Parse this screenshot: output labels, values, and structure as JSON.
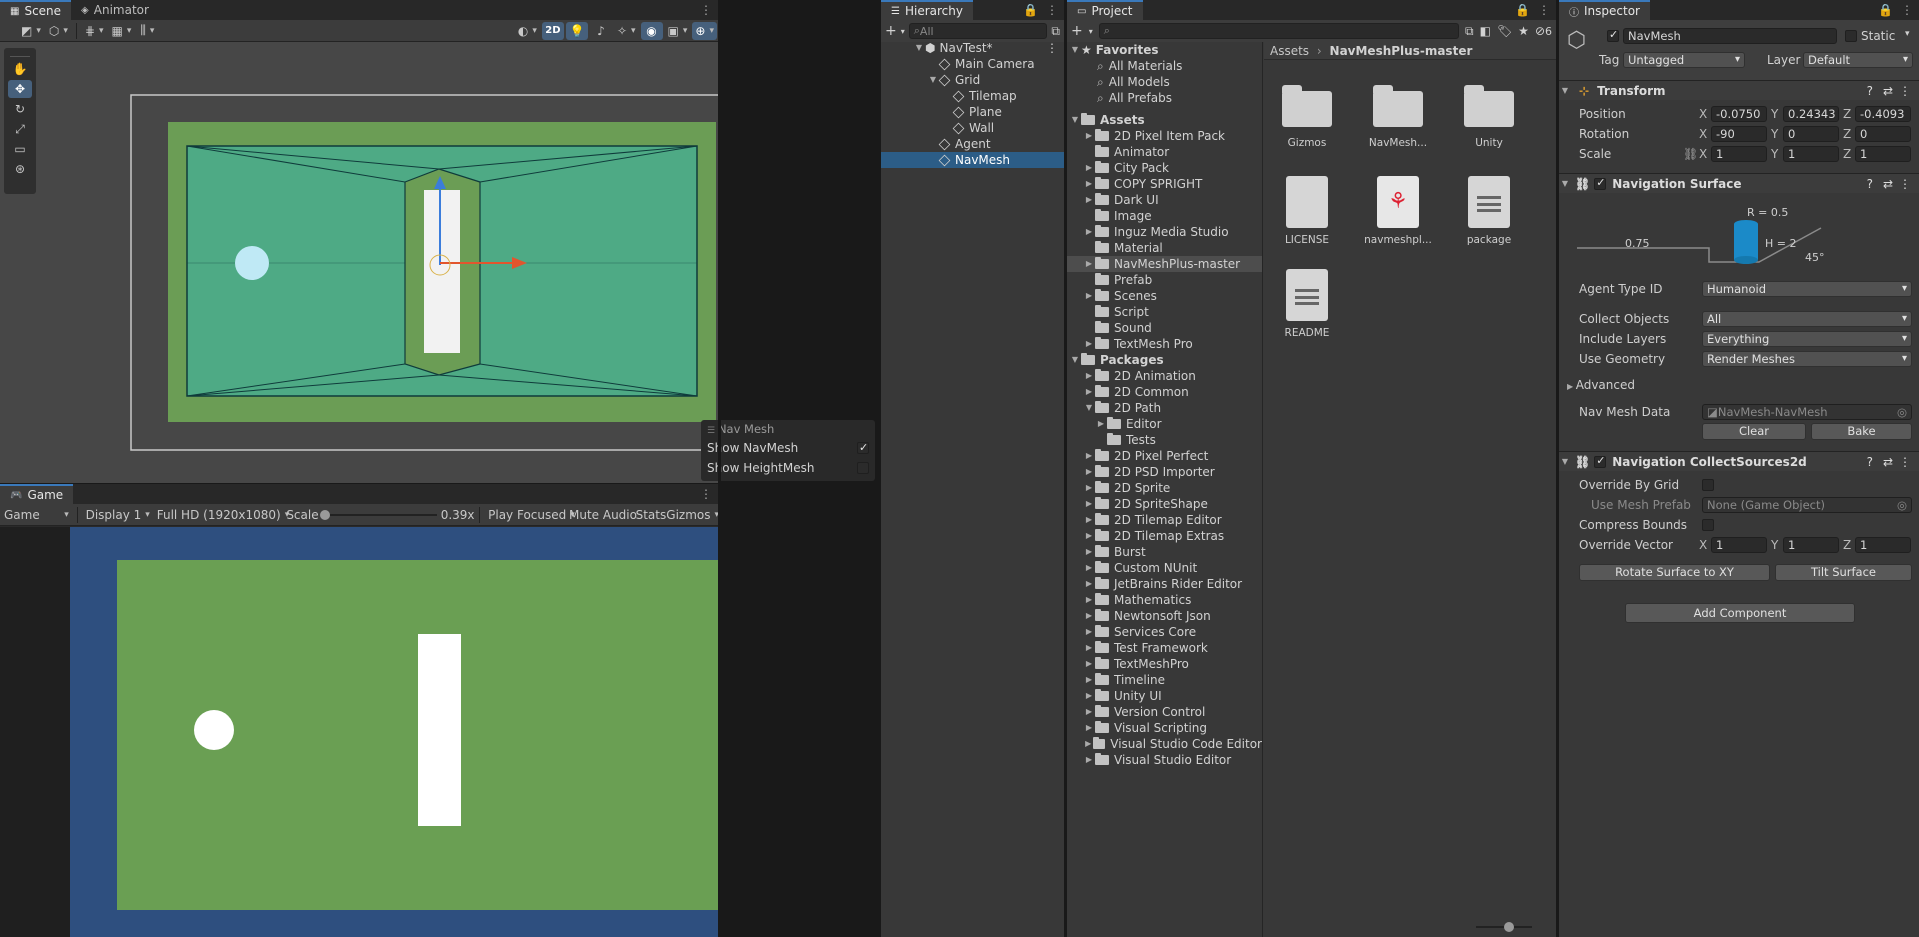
{
  "scene": {
    "tab_scene": "Scene",
    "tab_animator": "Animator",
    "btn_2d": "2D",
    "overlay": {
      "title": "Nav Mesh",
      "show_navmesh": "Show NavMesh",
      "show_heightmesh": "Show HeightMesh",
      "show_navmesh_checked": true,
      "show_heightmesh_checked": false
    }
  },
  "game": {
    "tab": "Game",
    "view": "Game",
    "display": "Display 1",
    "resolution": "Full HD (1920x1080)",
    "scale_label": "Scale",
    "scale_value": "0.39x",
    "play_mode": "Play Focused",
    "mute": "Mute Audio",
    "stats": "Stats",
    "gizmos": "Gizmos"
  },
  "hierarchy": {
    "tab": "Hierarchy",
    "search_placeholder": "All",
    "items": [
      {
        "label": "NavTest*"
      },
      {
        "label": "Main Camera"
      },
      {
        "label": "Grid"
      },
      {
        "label": "Tilemap"
      },
      {
        "label": "Plane"
      },
      {
        "label": "Wall"
      },
      {
        "label": "Agent"
      },
      {
        "label": "NavMesh"
      }
    ]
  },
  "project": {
    "tab": "Project",
    "hidden_count": "6",
    "breadcrumb_root": "Assets",
    "breadcrumb_current": "NavMeshPlus-master",
    "favorites_label": "Favorites",
    "favorites": [
      "All Materials",
      "All Models",
      "All Prefabs"
    ],
    "assets_label": "Assets",
    "assets": [
      "2D Pixel Item Pack",
      "Animator",
      "City Pack",
      "COPY SPRIGHT",
      "Dark UI",
      "Image",
      "Inguz Media Studio",
      "Material",
      "NavMeshPlus-master",
      "Prefab",
      "Scenes",
      "Script",
      "Sound",
      "TextMesh Pro"
    ],
    "packages_label": "Packages",
    "packages": [
      "2D Animation",
      "2D Common",
      "2D Path",
      "Editor",
      "Tests",
      "2D Pixel Perfect",
      "2D PSD Importer",
      "2D Sprite",
      "2D SpriteShape",
      "2D Tilemap Editor",
      "2D Tilemap Extras",
      "Burst",
      "Custom NUnit",
      "JetBrains Rider Editor",
      "Mathematics",
      "Newtonsoft Json",
      "Services Core",
      "Test Framework",
      "TextMeshPro",
      "Timeline",
      "Unity UI",
      "Version Control",
      "Visual Scripting",
      "Visual Studio Code Editor",
      "Visual Studio Editor"
    ],
    "grid": [
      {
        "label": "Gizmos",
        "kind": "folder"
      },
      {
        "label": "NavMesh...",
        "kind": "folder"
      },
      {
        "label": "Unity",
        "kind": "folder"
      },
      {
        "label": "LICENSE",
        "kind": "file"
      },
      {
        "label": "navmeshpl...",
        "kind": "pdf"
      },
      {
        "label": "package",
        "kind": "doc"
      },
      {
        "label": "README",
        "kind": "doc"
      }
    ]
  },
  "inspector": {
    "tab": "Inspector",
    "object_name": "NavMesh",
    "static_label": "Static",
    "tag_label": "Tag",
    "tag_value": "Untagged",
    "layer_label": "Layer",
    "layer_value": "Default",
    "transform": {
      "title": "Transform",
      "position_label": "Position",
      "rotation_label": "Rotation",
      "scale_label": "Scale",
      "position": [
        "-0.0750",
        "0.24343",
        "-0.4093"
      ],
      "rotation": [
        "-90",
        "0",
        "0"
      ],
      "scale": [
        "1",
        "1",
        "1"
      ]
    },
    "nav_surface": {
      "title": "Navigation Surface",
      "diagram_r": "R = 0.5",
      "diagram_h": "H = 2",
      "diagram_step": "0.75",
      "diagram_angle": "45°",
      "agent_type_label": "Agent Type ID",
      "agent_type_value": "Humanoid",
      "collect_label": "Collect Objects",
      "collect_value": "All",
      "layers_label": "Include Layers",
      "layers_value": "Everything",
      "geometry_label": "Use Geometry",
      "geometry_value": "Render Meshes",
      "advanced_label": "Advanced",
      "data_label": "Nav Mesh Data",
      "data_value": "NavMesh-NavMesh",
      "clear": "Clear",
      "bake": "Bake"
    },
    "collect_sources": {
      "title": "Navigation CollectSources2d",
      "override_grid_label": "Override By Grid",
      "use_prefab_label": "Use Mesh Prefab",
      "use_prefab_value": "None (Game Object)",
      "compress_label": "Compress Bounds",
      "override_vector_label": "Override Vector",
      "override_vector": [
        "1",
        "1",
        "1"
      ],
      "rotate_btn": "Rotate Surface to XY",
      "tilt_btn": "Tilt Surface"
    },
    "add_component": "Add Component",
    "axes": [
      "X",
      "Y",
      "Z"
    ]
  }
}
